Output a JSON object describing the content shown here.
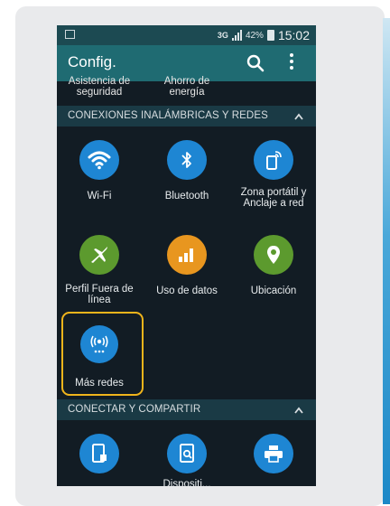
{
  "statusbar": {
    "network": "3G",
    "battery": "42%",
    "time": "15:02"
  },
  "actionbar": {
    "title": "Config."
  },
  "partial_items": [
    "Asistencia de seguridad",
    "Ahorro de energía"
  ],
  "sections": [
    {
      "label": "CONEXIONES INALÁMBRICAS Y REDES",
      "items": [
        {
          "label": "Wi-Fi",
          "icon": "wifi-icon",
          "color": "#1e86d3"
        },
        {
          "label": "Bluetooth",
          "icon": "bluetooth-icon",
          "color": "#1e86d3"
        },
        {
          "label": "Zona portátil y Anclaje a red",
          "icon": "hotspot-icon",
          "color": "#1e86d3"
        },
        {
          "label": "Perfil Fuera de línea",
          "icon": "airplane-icon",
          "color": "#5c9a2e"
        },
        {
          "label": "Uso de datos",
          "icon": "data-usage-icon",
          "color": "#e8961f"
        },
        {
          "label": "Ubicación",
          "icon": "location-icon",
          "color": "#5c9a2e"
        },
        {
          "label": "Más redes",
          "icon": "more-networks-icon",
          "color": "#1e86d3",
          "highlighted": true
        }
      ]
    },
    {
      "label": "CONECTAR Y COMPARTIR",
      "items": [
        {
          "label": "",
          "icon": "nfc-icon",
          "color": "#1e86d3"
        },
        {
          "label": "Dispositi...",
          "icon": "nearby-devices-icon",
          "color": "#1e86d3"
        },
        {
          "label": "",
          "icon": "printer-icon",
          "color": "#1e86d3"
        }
      ]
    }
  ],
  "highlight_color": "#f0b41b"
}
